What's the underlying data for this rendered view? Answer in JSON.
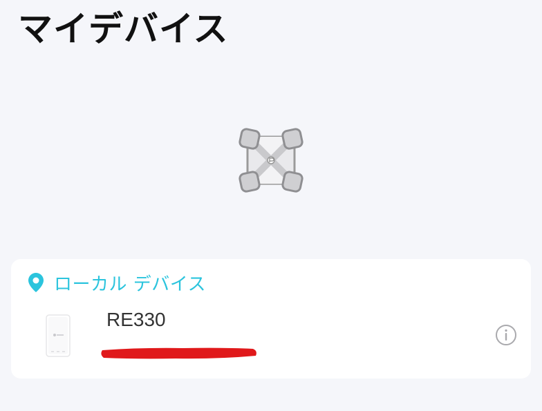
{
  "page": {
    "title": "マイデバイス"
  },
  "local_devices": {
    "section_label": "ローカル デバイス",
    "icon": "location-pin-icon",
    "items": [
      {
        "name": "RE330",
        "thumbnail_icon": "range-extender-icon",
        "detail_redacted": true
      }
    ]
  },
  "colors": {
    "background": "#f5f6fa",
    "accent": "#2bc4dd",
    "redaction": "#e0191b"
  }
}
